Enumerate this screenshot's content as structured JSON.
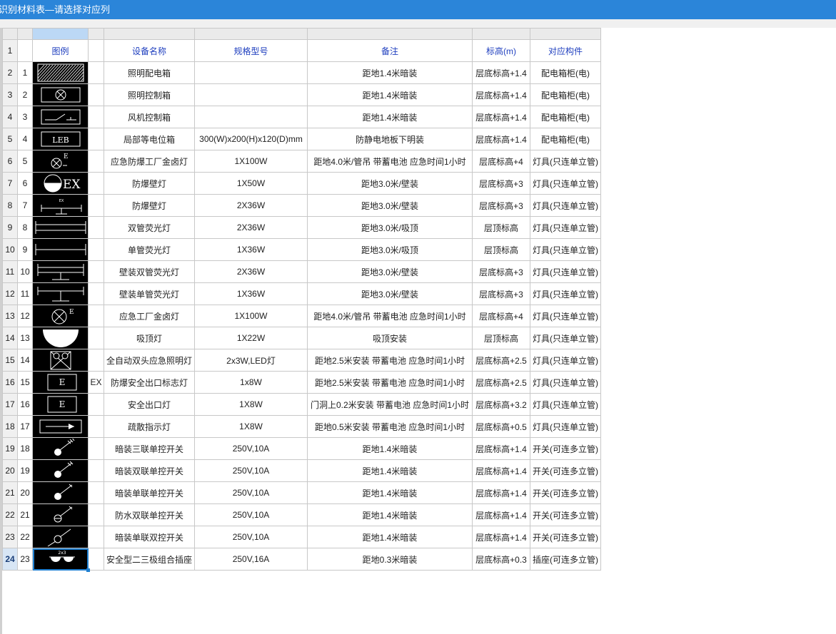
{
  "window": {
    "title": "识别材料表—请选择对应列"
  },
  "headers": {
    "legend": "图例",
    "name": "设备名称",
    "spec": "规格型号",
    "remark": "备注",
    "elevation": "标高(m)",
    "component": "对应构件"
  },
  "header_row_number": "1",
  "rows": [
    {
      "row": "2",
      "no": "1",
      "symbol": "hatched-panel-icon",
      "extra": "",
      "name": "照明配电箱",
      "spec": "",
      "remark": "距地1.4米暗装",
      "elevation": "层底标高+1.4",
      "component": "配电箱柜(电)"
    },
    {
      "row": "3",
      "no": "2",
      "symbol": "lighting-control-box-icon",
      "extra": "",
      "name": "照明控制箱",
      "spec": "",
      "remark": "距地1.4米暗装",
      "elevation": "层底标高+1.4",
      "component": "配电箱柜(电)"
    },
    {
      "row": "4",
      "no": "3",
      "symbol": "fan-control-box-icon",
      "extra": "",
      "name": "风机控制箱",
      "spec": "",
      "remark": "距地1.4米暗装",
      "elevation": "层底标高+1.4",
      "component": "配电箱柜(电)"
    },
    {
      "row": "5",
      "no": "4",
      "symbol": "leb-box-icon",
      "symbol_text": "LEB",
      "extra": "",
      "name": "局部等电位箱",
      "spec": "300(W)x200(H)x120(D)mm",
      "remark": "防静电地板下明装",
      "elevation": "层底标高+1.4",
      "component": "配电箱柜(电)"
    },
    {
      "row": "6",
      "no": "5",
      "symbol": "emergency-explosion-proof-lamp-icon",
      "symbol_text": "E",
      "extra": "",
      "name": "应急防爆工厂金卤灯",
      "spec": "1X100W",
      "remark": "距地4.0米/管吊 带蓄电池 应急时间1小时",
      "elevation": "层底标高+4",
      "component": "灯具(只连单立管)"
    },
    {
      "row": "7",
      "no": "6",
      "symbol": "explosion-proof-wall-lamp-icon",
      "symbol_text": "EX",
      "extra": "",
      "name": "防爆壁灯",
      "spec": "1X50W",
      "remark": "距地3.0米/壁装",
      "elevation": "层底标高+3",
      "component": "灯具(只连单立管)"
    },
    {
      "row": "8",
      "no": "7",
      "symbol": "explosion-proof-wall-fluorescent-icon",
      "symbol_text": "EX",
      "extra": "",
      "name": "防爆壁灯",
      "spec": "2X36W",
      "remark": "距地3.0米/壁装",
      "elevation": "层底标高+3",
      "component": "灯具(只连单立管)"
    },
    {
      "row": "9",
      "no": "8",
      "symbol": "double-tube-fluorescent-icon",
      "extra": "",
      "name": "双管荧光灯",
      "spec": "2X36W",
      "remark": "距地3.0米/吸顶",
      "elevation": "层顶标高",
      "component": "灯具(只连单立管)"
    },
    {
      "row": "10",
      "no": "9",
      "symbol": "single-tube-fluorescent-icon",
      "extra": "",
      "name": "单管荧光灯",
      "spec": "1X36W",
      "remark": "距地3.0米/吸顶",
      "elevation": "层顶标高",
      "component": "灯具(只连单立管)"
    },
    {
      "row": "11",
      "no": "10",
      "symbol": "wall-double-tube-fluorescent-icon",
      "extra": "",
      "name": "壁装双管荧光灯",
      "spec": "2X36W",
      "remark": "距地3.0米/壁装",
      "elevation": "层底标高+3",
      "component": "灯具(只连单立管)"
    },
    {
      "row": "12",
      "no": "11",
      "symbol": "wall-single-tube-fluorescent-icon",
      "extra": "",
      "name": "壁装单管荧光灯",
      "spec": "1X36W",
      "remark": "距地3.0米/壁装",
      "elevation": "层底标高+3",
      "component": "灯具(只连单立管)"
    },
    {
      "row": "13",
      "no": "12",
      "symbol": "emergency-factory-lamp-icon",
      "symbol_text": "E",
      "extra": "",
      "name": "应急工厂金卤灯",
      "spec": "1X100W",
      "remark": "距地4.0米/管吊 带蓄电池 应急时间1小时",
      "elevation": "层底标高+4",
      "component": "灯具(只连单立管)"
    },
    {
      "row": "14",
      "no": "13",
      "symbol": "ceiling-lamp-icon",
      "extra": "",
      "name": "吸顶灯",
      "spec": "1X22W",
      "remark": "吸顶安装",
      "elevation": "层顶标高",
      "component": "灯具(只连单立管)"
    },
    {
      "row": "15",
      "no": "14",
      "symbol": "twin-head-emergency-light-icon",
      "extra": "",
      "name": "全自动双头应急照明灯",
      "spec": "2x3W,LED灯",
      "remark": "距地2.5米安装 带蓄电池 应急时间1小时",
      "elevation": "层底标高+2.5",
      "component": "灯具(只连单立管)"
    },
    {
      "row": "16",
      "no": "15",
      "symbol": "exit-sign-box-icon",
      "symbol_text": "E",
      "extra": "EX",
      "name": "防爆安全出口标志灯",
      "spec": "1x8W",
      "remark": "距地2.5米安装 带蓄电池 应急时间1小时",
      "elevation": "层底标高+2.5",
      "component": "灯具(只连单立管)"
    },
    {
      "row": "17",
      "no": "16",
      "symbol": "exit-sign-box-icon",
      "symbol_text": "E",
      "extra": "",
      "name": "安全出口灯",
      "spec": "1X8W",
      "remark": "门洞上0.2米安装 带蓄电池 应急时间1小时",
      "elevation": "层底标高+3.2",
      "component": "灯具(只连单立管)"
    },
    {
      "row": "18",
      "no": "17",
      "symbol": "evacuation-arrow-icon",
      "extra": "",
      "name": "疏散指示灯",
      "spec": "1X8W",
      "remark": "距地0.5米安装 带蓄电池 应急时间1小时",
      "elevation": "层底标高+0.5",
      "component": "灯具(只连单立管)"
    },
    {
      "row": "19",
      "no": "18",
      "symbol": "triple-switch-icon",
      "extra": "",
      "name": "暗装三联单控开关",
      "spec": "250V,10A",
      "remark": "距地1.4米暗装",
      "elevation": "层底标高+1.4",
      "component": "开关(可连多立管)"
    },
    {
      "row": "20",
      "no": "19",
      "symbol": "double-switch-icon",
      "extra": "",
      "name": "暗装双联单控开关",
      "spec": "250V,10A",
      "remark": "距地1.4米暗装",
      "elevation": "层底标高+1.4",
      "component": "开关(可连多立管)"
    },
    {
      "row": "21",
      "no": "20",
      "symbol": "single-switch-icon",
      "extra": "",
      "name": "暗装单联单控开关",
      "spec": "250V,10A",
      "remark": "距地1.4米暗装",
      "elevation": "层底标高+1.4",
      "component": "开关(可连多立管)"
    },
    {
      "row": "22",
      "no": "21",
      "symbol": "waterproof-switch-icon",
      "extra": "",
      "name": "防水双联单控开关",
      "spec": "250V,10A",
      "remark": "距地1.4米暗装",
      "elevation": "层底标高+1.4",
      "component": "开关(可连多立管)"
    },
    {
      "row": "23",
      "no": "22",
      "symbol": "two-way-switch-icon",
      "extra": "",
      "name": "暗装单联双控开关",
      "spec": "250V,10A",
      "remark": "距地1.4米暗装",
      "elevation": "层底标高+1.4",
      "component": "开关(可连多立管)"
    },
    {
      "row": "24",
      "no": "23",
      "symbol": "combo-socket-icon",
      "symbol_text": "2x3",
      "extra": "",
      "name": "安全型二三极组合插座",
      "spec": "250V,16A",
      "remark": "距地0.3米暗装",
      "elevation": "层底标高+0.3",
      "component": "插座(可连多立管)"
    }
  ],
  "selection": {
    "active_row": "24",
    "selected_column": "图例"
  }
}
